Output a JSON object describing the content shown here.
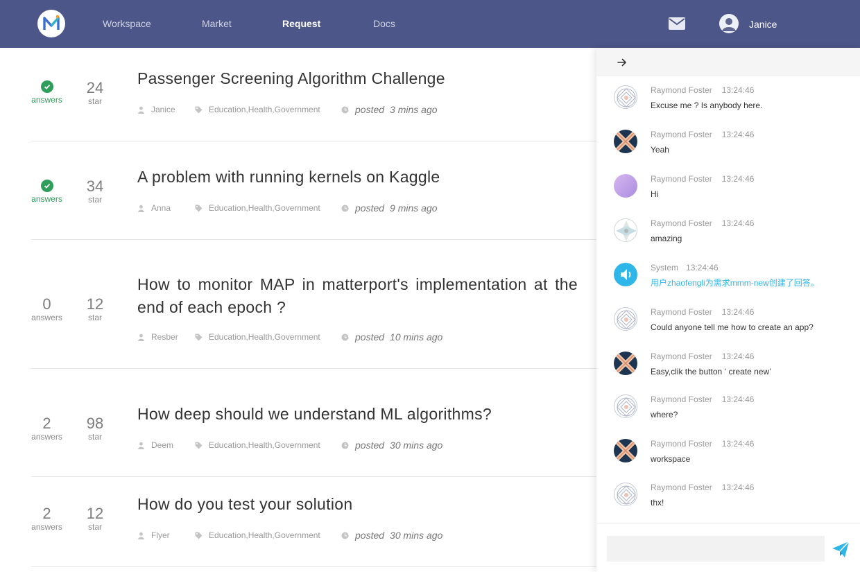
{
  "nav": {
    "logo_letter": "M",
    "links": [
      "Workspace",
      "Market",
      "Request",
      "Docs"
    ],
    "active": "Request",
    "user": "Janice"
  },
  "requests": [
    {
      "answers": "",
      "answered": true,
      "answers_label": "answers",
      "stars": "24",
      "star_label": "star",
      "title": "Passenger Screening Algorithm Challenge",
      "author": "Janice",
      "tags": "Education,Health,Government",
      "posted_label": "posted",
      "time": "3 mins ago"
    },
    {
      "answers": "",
      "answered": true,
      "answers_label": "answers",
      "stars": "34",
      "star_label": "star",
      "title": "A problem with running kernels on Kaggle",
      "author": "Anna",
      "tags": "Education,Health,Government",
      "posted_label": "posted",
      "time": "9 mins ago"
    },
    {
      "answers": "0",
      "answered": false,
      "answers_label": "answers",
      "stars": "12",
      "star_label": "star",
      "title": "How to monitor MAP in matterport's implementation at the end of each epoch ?",
      "author": "Resber",
      "tags": "Education,Health,Government",
      "posted_label": "posted",
      "time": "10 mins ago"
    },
    {
      "answers": "2",
      "answered": false,
      "answers_label": "answers",
      "stars": "98",
      "star_label": "star",
      "title": "How deep should we understand ML algorithms?",
      "author": "Deem",
      "tags": "Education,Health,Government",
      "posted_label": "posted",
      "time": "30 mins ago"
    },
    {
      "answers": "2",
      "answered": false,
      "answers_label": "answers",
      "stars": "12",
      "star_label": "star",
      "title": "How do you test your solution",
      "author": "Flyer",
      "tags": "Education,Health,Government",
      "posted_label": "posted",
      "time": "30 mins ago"
    }
  ],
  "chat": {
    "messages": [
      {
        "name": "Raymond Foster",
        "time": "13:24:46",
        "text": "Excuse me ? Is anybody here.",
        "avatar": "pattern-icon"
      },
      {
        "name": "Raymond Foster",
        "time": "13:24:46",
        "text": "Yeah",
        "avatar": "x-icon"
      },
      {
        "name": "Raymond Foster",
        "time": "13:24:46",
        "text": "Hi",
        "avatar": "gradient-avatar"
      },
      {
        "name": "Raymond Foster",
        "time": "13:24:46",
        "text": "amazing",
        "avatar": "diamond-pattern-icon"
      },
      {
        "name": "System",
        "time": "13:24:46",
        "text": "用户zhaofengli为需求mmm-new创建了回答。",
        "avatar": "speaker-icon",
        "system": true
      },
      {
        "name": "Raymond Foster",
        "time": "13:24:46",
        "text": "Could anyone tell me how to create an app?",
        "avatar": "pattern-icon"
      },
      {
        "name": "Raymond Foster",
        "time": "13:24:46",
        "text": "Easy,clik the button ‘ create new’",
        "avatar": "x-icon"
      },
      {
        "name": "Raymond Foster",
        "time": "13:24:46",
        "text": "where?",
        "avatar": "pattern-icon"
      },
      {
        "name": "Raymond Foster",
        "time": "13:24:46",
        "text": "workspace",
        "avatar": "x-icon"
      },
      {
        "name": "Raymond Foster",
        "time": "13:24:46",
        "text": "thx!",
        "avatar": "pattern-icon"
      }
    ],
    "input_value": "",
    "colors": {
      "system_text": "#2eb6e8",
      "nav_bg": "#4c5688",
      "answered_green": "#2f9e5a"
    }
  }
}
